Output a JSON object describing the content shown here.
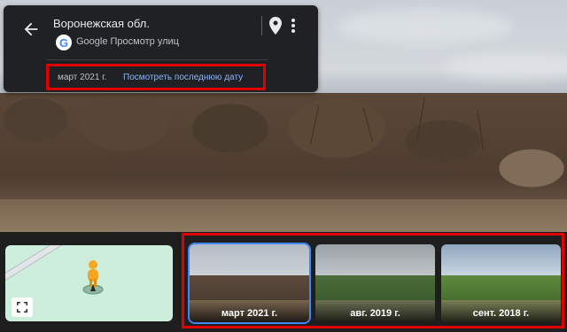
{
  "info_card": {
    "place_title": "Воронежская обл.",
    "provider": "Google Просмотр улиц",
    "current_date": "март 2021 г.",
    "latest_link": "Посмотреть последнюю дату"
  },
  "timeline": {
    "thumbnails": [
      {
        "label": "март 2021 г.",
        "selected": true
      },
      {
        "label": "авг. 2019 г.",
        "selected": false
      },
      {
        "label": "сент. 2018 г.",
        "selected": false
      }
    ]
  },
  "icons": {
    "back": "back-arrow-icon",
    "pin": "map-pin-icon",
    "more": "more-vert-icon",
    "google": "google-g-icon",
    "pegman": "pegman-icon",
    "expand": "fullscreen-icon"
  },
  "colors": {
    "highlight": "#e00000",
    "link": "#8ab4f8",
    "selected_border": "#4285f4"
  }
}
